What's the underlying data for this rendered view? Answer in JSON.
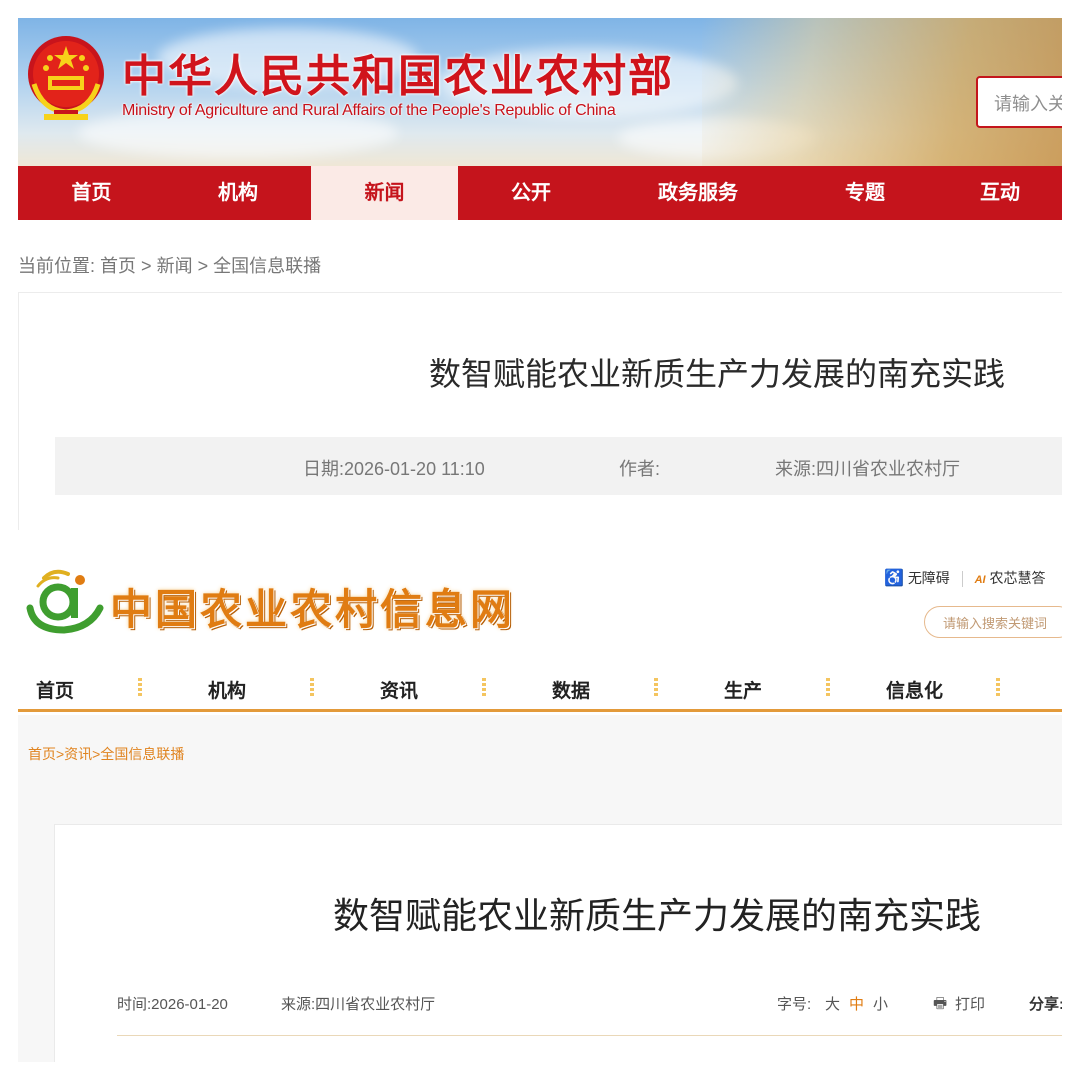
{
  "moa": {
    "site_title": "中华人民共和国农业农村部",
    "site_subtitle": "Ministry of Agriculture and Rural Affairs of the People's Republic of China",
    "search_placeholder": "请输入关",
    "nav": [
      "首页",
      "机构",
      "新闻",
      "公开",
      "政务服务",
      "专题",
      "互动"
    ],
    "active_nav": "新闻",
    "breadcrumb": {
      "label": "当前位置:",
      "items": [
        "首页",
        "新闻",
        "全国信息联播"
      ],
      "separator": ">"
    },
    "article": {
      "title": "数智赋能农业新质生产力发展的南充实践",
      "date": "日期:2026-01-20 11:10",
      "author": "作者:",
      "source": "来源:四川省农业农村厅"
    },
    "colors": {
      "brand_red": "#c5141c",
      "active_tab_bg": "#fbeae6"
    }
  },
  "agri": {
    "site_title": "中国农业农村信息网",
    "tools": [
      "无障碍",
      "农芯慧答"
    ],
    "search_placeholder": "请输入搜索关键词",
    "nav": [
      "首页",
      "机构",
      "资讯",
      "数据",
      "生产",
      "信息化"
    ],
    "breadcrumb": "首页>资讯>全国信息联播",
    "article": {
      "title": "数智赋能农业新质生产力发展的南充实践",
      "time": "时间:2026-01-20",
      "source": "来源:四川省农业农村厅",
      "font_size_label": "字号:",
      "font_sizes": [
        "大",
        "中",
        "小"
      ],
      "print": "打印",
      "share": "分享:"
    },
    "colors": {
      "brand_orange": "#e07c12",
      "nav_underline": "#e39a3a"
    }
  }
}
